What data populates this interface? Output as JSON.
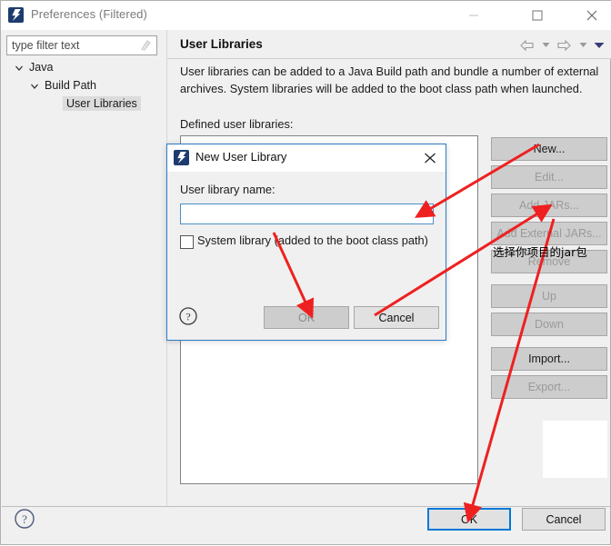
{
  "window": {
    "title": "Preferences (Filtered)",
    "icon": "eclipse-icon",
    "controls": {
      "minimize": "minimize-icon",
      "maximize": "maximize-icon",
      "close": "close-icon"
    }
  },
  "sidebar": {
    "filter": {
      "placeholder": "type filter text",
      "value": "",
      "clear_icon": "clear-filter-icon"
    },
    "tree": [
      {
        "label": "Java",
        "indent": 0,
        "expanded": true,
        "selected": false
      },
      {
        "label": "Build Path",
        "indent": 1,
        "expanded": true,
        "selected": false
      },
      {
        "label": "User Libraries",
        "indent": 2,
        "expanded": null,
        "selected": true
      }
    ]
  },
  "content": {
    "title": "User Libraries",
    "nav": {
      "back_icon": "back-arrow-icon",
      "back_menu_icon": "chevron-down-icon",
      "forward_icon": "forward-arrow-icon",
      "forward_menu_icon": "chevron-down-icon",
      "menu_icon": "chevron-down-filled-icon"
    },
    "description": "User libraries can be added to a Java Build path and bundle a number of external archives. System libraries will be added to the boot class path when launched.",
    "subtitle": "Defined user libraries:",
    "list_items": [],
    "buttons": [
      {
        "label": "New...",
        "enabled": true
      },
      {
        "label": "Edit...",
        "enabled": false
      },
      {
        "label": "Add JARs...",
        "enabled": false
      },
      {
        "label": "Add External JARs...",
        "enabled": false
      },
      {
        "label": "Remove",
        "enabled": false
      },
      {
        "label": "Up",
        "enabled": false,
        "group_gap": true
      },
      {
        "label": "Down",
        "enabled": false
      },
      {
        "label": "Import...",
        "enabled": true,
        "group_gap": true
      },
      {
        "label": "Export...",
        "enabled": false
      }
    ]
  },
  "footer": {
    "help_icon": "help-icon",
    "ok_label": "OK",
    "cancel_label": "Cancel"
  },
  "dialog": {
    "icon": "eclipse-icon",
    "title": "New User Library",
    "close_icon": "close-icon",
    "field_label": "User library name:",
    "field_value": "",
    "checkbox_label": "System library (added to the boot class path)",
    "checkbox_checked": false,
    "help_icon": "help-icon",
    "ok_label": "OK",
    "ok_enabled": false,
    "cancel_label": "Cancel"
  },
  "annotations": {
    "note_text": "选择你项目的jar包",
    "arrow_color": "#ef2020",
    "arrows": [
      {
        "name": "arrow-to-name-field",
        "from_label": "New...",
        "to_label": "name-input"
      },
      {
        "name": "arrow-to-add-jars",
        "from_label": "dialog-ok",
        "to_label": "Add JARs..."
      },
      {
        "name": "arrow-to-dialog-ok",
        "from_label": "checkbox-area",
        "to_label": "dialog-ok"
      },
      {
        "name": "arrow-to-bottom-ok",
        "from_label": "Add JARs...",
        "to_label": "bottom-ok"
      }
    ]
  },
  "colors": {
    "accent": "#0078d7",
    "window_bg": "#f0f0f0",
    "button_bg": "#cdcdcd",
    "annotation_red": "#ef2020",
    "eclipse_icon": "#1d3c6e"
  }
}
